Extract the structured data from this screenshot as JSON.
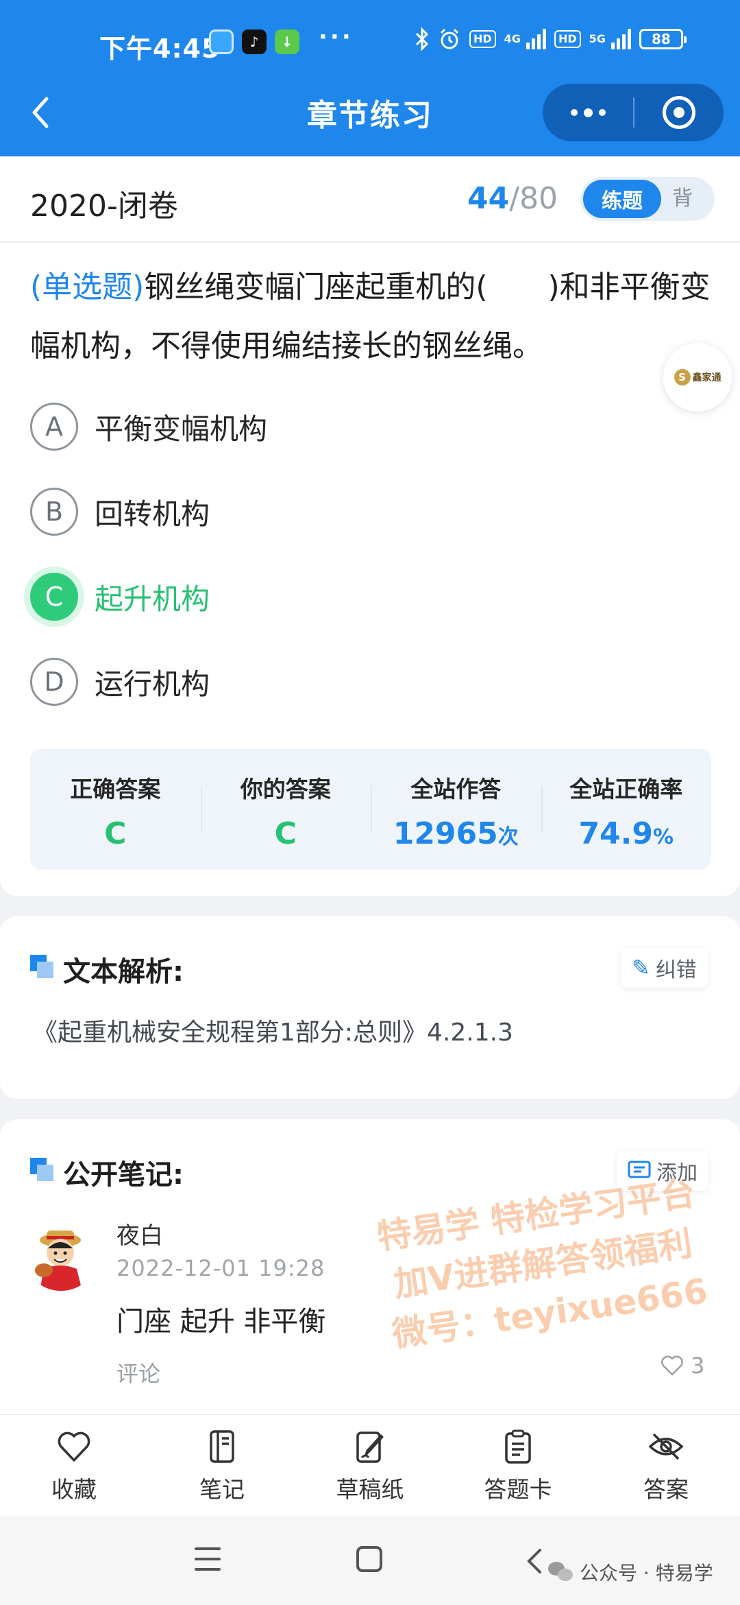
{
  "status_bar": {
    "time": "下午4:45",
    "more": "···",
    "net1": "4G",
    "net2": "5G",
    "hd": "HD",
    "battery": "88"
  },
  "nav": {
    "title": "章节练习"
  },
  "header": {
    "exam_name": "2020-闭卷",
    "current": "44",
    "separator": "/",
    "total": "80",
    "mode_active": "练题",
    "mode_inactive": "背"
  },
  "question": {
    "type": "(单选题)",
    "text": "钢丝绳变幅门座起重机的(　　)和非平衡变幅机构，不得使用编结接长的钢丝绳。"
  },
  "float_badge": "鑫家通",
  "options": [
    {
      "key": "A",
      "text": "平衡变幅机构",
      "state": "normal"
    },
    {
      "key": "B",
      "text": "回转机构",
      "state": "normal"
    },
    {
      "key": "C",
      "text": "起升机构",
      "state": "correct"
    },
    {
      "key": "D",
      "text": "运行机构",
      "state": "normal"
    }
  ],
  "stats": {
    "correct_label": "正确答案",
    "correct_value": "C",
    "yours_label": "你的答案",
    "yours_value": "C",
    "total_label": "全站作答",
    "total_value": "12965",
    "total_unit": "次",
    "rate_label": "全站正确率",
    "rate_value": "74.9",
    "rate_unit": "%"
  },
  "analysis": {
    "title": "文本解析:",
    "report_button": "纠错",
    "text": "《起重机械安全规程第1部分:总则》4.2.1.3"
  },
  "notes": {
    "title": "公开笔记:",
    "add_button": "添加",
    "items": [
      {
        "user": "夜白",
        "time": "2022-12-01 19:28",
        "content": "门座 起升 非平衡",
        "comment": "评论",
        "likes": "3"
      }
    ]
  },
  "watermark": {
    "line1": "特易学 特检学习平台",
    "line2": "加V进群解答领福利",
    "line3": "微号：teyixue666"
  },
  "toolbar": {
    "items": [
      {
        "label": "收藏",
        "icon": "heart-icon"
      },
      {
        "label": "笔记",
        "icon": "notebook-icon"
      },
      {
        "label": "草稿纸",
        "icon": "draft-paper-icon"
      },
      {
        "label": "答题卡",
        "icon": "answer-sheet-icon"
      },
      {
        "label": "答案",
        "icon": "eye-off-icon"
      }
    ]
  },
  "footer_mark": "公众号 · 特易学",
  "colors": {
    "primary": "#1f86ec",
    "correct": "#27c173",
    "watermark": "#f7a46e"
  }
}
